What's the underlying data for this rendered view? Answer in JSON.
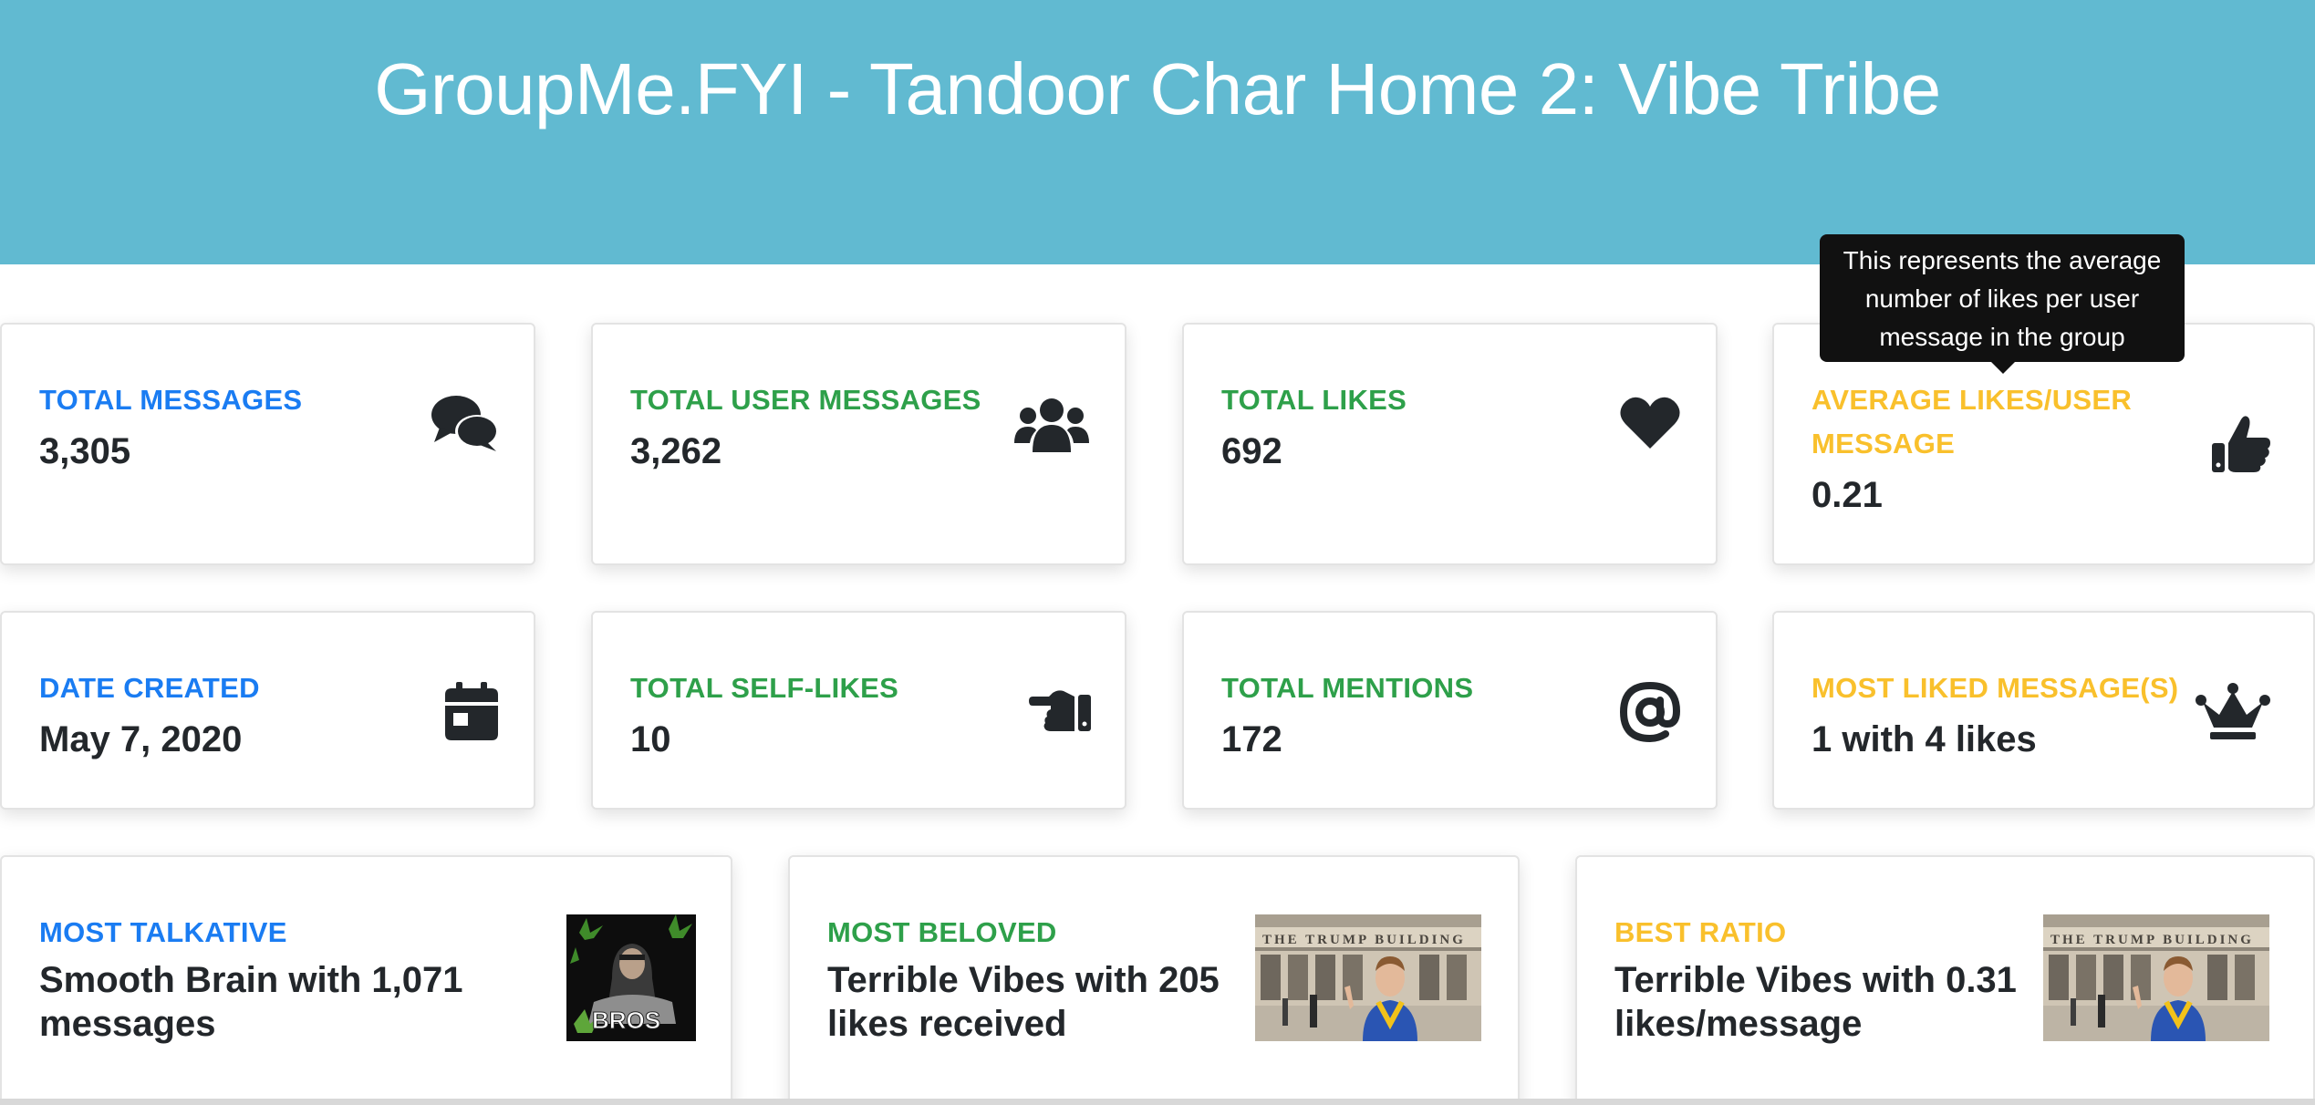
{
  "header": {
    "title": "GroupMe.FYI - Tandoor Char Home 2: Vibe Tribe",
    "background": "#61bad1"
  },
  "colors": {
    "primary": "#1a7cf2",
    "success": "#2ea04a",
    "warning": "#f9c02c",
    "value_text": "#23272b",
    "tooltip_bg": "#111111"
  },
  "stats": {
    "total_messages": {
      "label": "TOTAL MESSAGES",
      "value": "3,305",
      "icon": "comments-icon"
    },
    "total_user_messages": {
      "label": "TOTAL USER MESSAGES",
      "value": "3,262",
      "icon": "users-icon"
    },
    "total_likes": {
      "label": "TOTAL LIKES",
      "value": "692",
      "icon": "heart-icon"
    },
    "average_likes": {
      "label_line1": "AVERAGE LIKES/USER",
      "label_line2": "MESSAGE",
      "value": "0.21",
      "icon": "thumbs-up-icon",
      "tooltip_line1": "This represents the average",
      "tooltip_line2": "number of likes per user",
      "tooltip_line3": "message in the group"
    },
    "date_created": {
      "label": "DATE CREATED",
      "value": "May 7, 2020",
      "icon": "calendar-icon"
    },
    "total_self_likes": {
      "label": "TOTAL SELF-LIKES",
      "value": "10",
      "icon": "hand-point-left-icon"
    },
    "total_mentions": {
      "label": "TOTAL MENTIONS",
      "value": "172",
      "icon": "at-icon"
    },
    "most_liked": {
      "label": "MOST LIKED MESSAGE(S)",
      "value": "1 with 4 likes",
      "icon": "crown-icon"
    }
  },
  "leaders": {
    "most_talkative": {
      "label": "MOST TALKATIVE",
      "line1": "Smooth Brain with 1,071",
      "line2": "messages",
      "avatar_text": "BROS"
    },
    "most_beloved": {
      "label": "MOST BELOVED",
      "line1": "Terrible Vibes with 205",
      "line2": "likes received",
      "avatar_text": "THE TRUMP BUILDING"
    },
    "best_ratio": {
      "label": "BEST RATIO",
      "line1": "Terrible Vibes with 0.31",
      "line2": "likes/message",
      "avatar_text": "THE TRUMP BUILDING"
    }
  }
}
